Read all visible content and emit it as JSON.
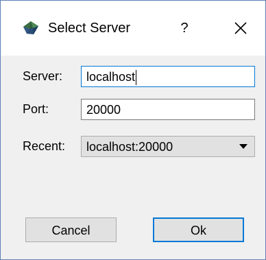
{
  "dialog": {
    "title": "Select Server",
    "help_label": "?",
    "app_icon": "app-logo-icon",
    "close_icon": "close-icon"
  },
  "form": {
    "server_label": "Server:",
    "server_value": "localhost",
    "port_label": "Port:",
    "port_value": "20000",
    "recent_label": "Recent:",
    "recent_value": "localhost:20000"
  },
  "buttons": {
    "cancel_label": "Cancel",
    "ok_label": "Ok"
  },
  "colors": {
    "accent": "#0078d7",
    "window_border": "#5a80b4",
    "background": "#f0f0f0",
    "button_face": "#e1e1e1"
  }
}
